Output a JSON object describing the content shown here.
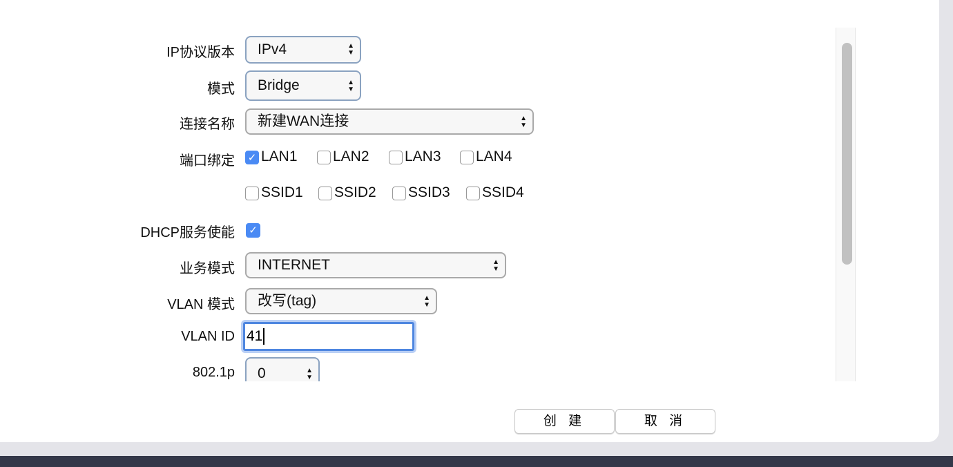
{
  "form": {
    "ip_version": {
      "label": "IP协议版本",
      "value": "IPv4"
    },
    "mode": {
      "label": "模式",
      "value": "Bridge"
    },
    "connection_name": {
      "label": "连接名称",
      "value": "新建WAN连接"
    },
    "port_binding": {
      "label": "端口绑定",
      "options": [
        {
          "label": "LAN1",
          "checked": true
        },
        {
          "label": "LAN2",
          "checked": false
        },
        {
          "label": "LAN3",
          "checked": false
        },
        {
          "label": "LAN4",
          "checked": false
        },
        {
          "label": "SSID1",
          "checked": false
        },
        {
          "label": "SSID2",
          "checked": false
        },
        {
          "label": "SSID3",
          "checked": false
        },
        {
          "label": "SSID4",
          "checked": false
        }
      ]
    },
    "dhcp": {
      "label": "DHCP服务使能",
      "checked": true
    },
    "service_mode": {
      "label": "业务模式",
      "value": "INTERNET"
    },
    "vlan_mode": {
      "label": "VLAN 模式",
      "value": "改写(tag)"
    },
    "vlan_id": {
      "label": "VLAN ID",
      "value": "41"
    },
    "priority": {
      "label": "802.1p",
      "value": "0"
    }
  },
  "buttons": {
    "create": "创 建",
    "cancel": "取 消"
  },
  "colors": {
    "accent": "#4a8af4",
    "bottom_bar": "#343849"
  }
}
